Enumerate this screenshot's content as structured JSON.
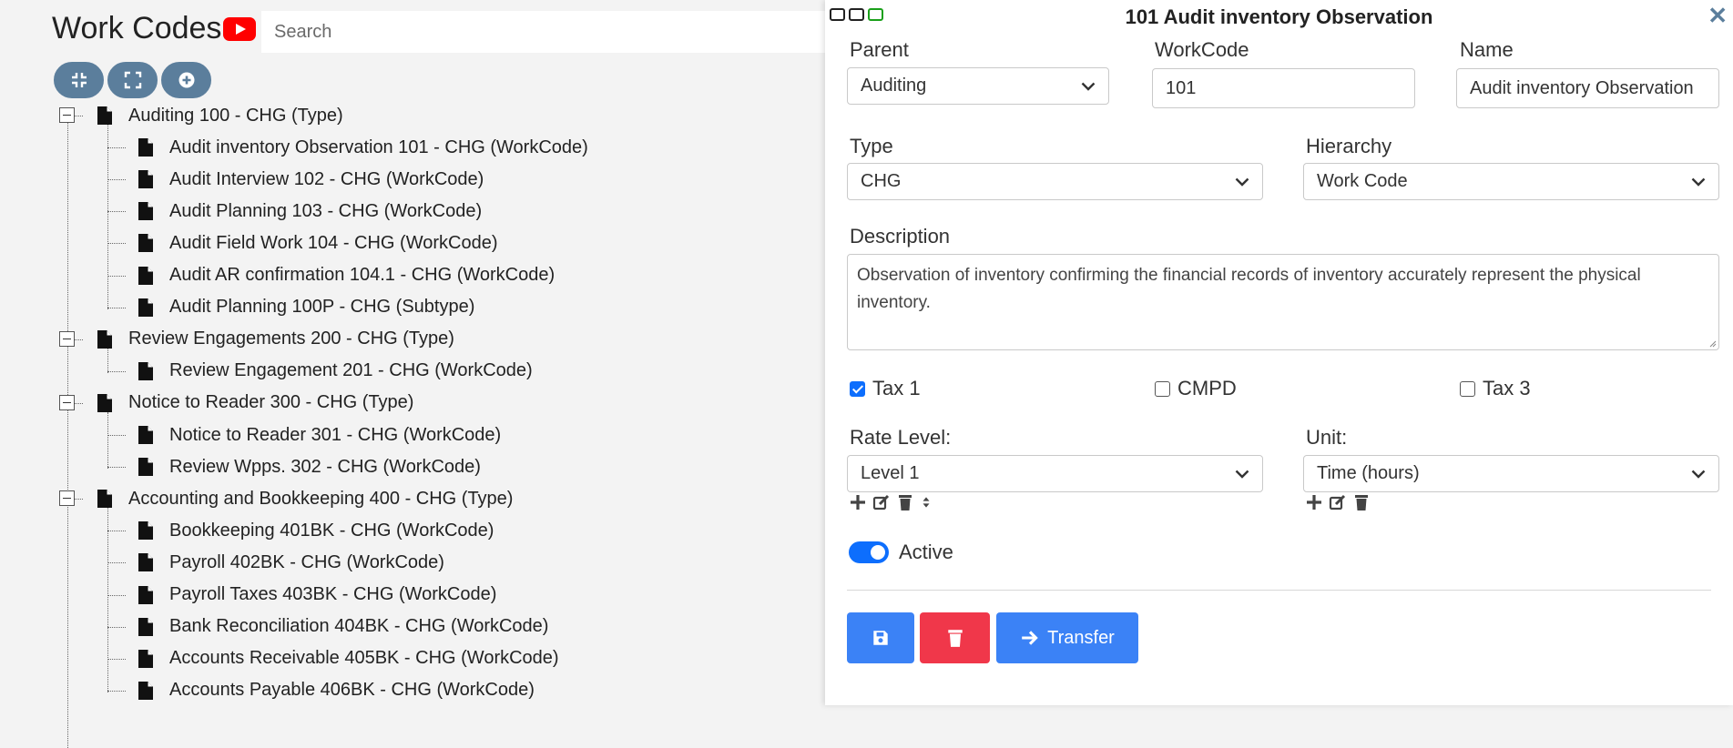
{
  "app": {
    "title": "Work Codes",
    "search_placeholder": "Search"
  },
  "toolbar": {
    "collapse_icon": "compress-icon",
    "expand_icon": "expand-icon",
    "add_icon": "plus-circle-icon"
  },
  "tree": {
    "groups": [
      {
        "label": "Auditing 100 - CHG (Type)",
        "children": [
          "Audit inventory Observation 101 - CHG (WorkCode)",
          "Audit Interview 102 - CHG (WorkCode)",
          "Audit Planning 103 - CHG (WorkCode)",
          "Audit Field Work 104 - CHG (WorkCode)",
          "Audit AR confirmation 104.1 - CHG (WorkCode)",
          "Audit Planning 100P - CHG (Subtype)"
        ]
      },
      {
        "label": "Review Engagements 200 - CHG (Type)",
        "children": [
          "Review Engagement 201 - CHG (WorkCode)"
        ]
      },
      {
        "label": "Notice to Reader 300 - CHG (Type)",
        "children": [
          "Notice to Reader 301 - CHG (WorkCode)",
          "Review Wpps. 302 - CHG (WorkCode)"
        ]
      },
      {
        "label": "Accounting and Bookkeeping 400 - CHG (Type)",
        "children": [
          "Bookkeeping 401BK - CHG (WorkCode)",
          "Payroll 402BK - CHG (WorkCode)",
          "Payroll Taxes 403BK - CHG (WorkCode)",
          "Bank Reconciliation 404BK - CHG (WorkCode)",
          "Accounts Receivable 405BK - CHG (WorkCode)",
          "Accounts Payable 406BK - CHG (WorkCode)"
        ]
      }
    ]
  },
  "panel": {
    "title": "101 Audit inventory Observation",
    "parent_label": "Parent",
    "parent_value": "Auditing",
    "workcode_label": "WorkCode",
    "workcode_value": "101",
    "name_label": "Name",
    "name_value": "Audit inventory Observation",
    "type_label": "Type",
    "type_value": "CHG",
    "hierarchy_label": "Hierarchy",
    "hierarchy_value": "Work Code",
    "description_label": "Description",
    "description_value": "Observation of inventory confirming the financial records of inventory accurately represent the physical inventory.",
    "tax1_label": "Tax 1",
    "tax1_checked": true,
    "cmpd_label": "CMPD",
    "cmpd_checked": false,
    "tax3_label": "Tax 3",
    "tax3_checked": false,
    "rate_level_label": "Rate Level:",
    "rate_level_value": "Level 1",
    "unit_label": "Unit:",
    "unit_value": "Time (hours)",
    "active_label": "Active",
    "active_on": true,
    "transfer_label": "Transfer"
  },
  "colors": {
    "accent": "#3b82f6",
    "danger": "#f0374a",
    "toolbar_button": "#5b7e9c",
    "toggle_on": "#0d6efd"
  }
}
